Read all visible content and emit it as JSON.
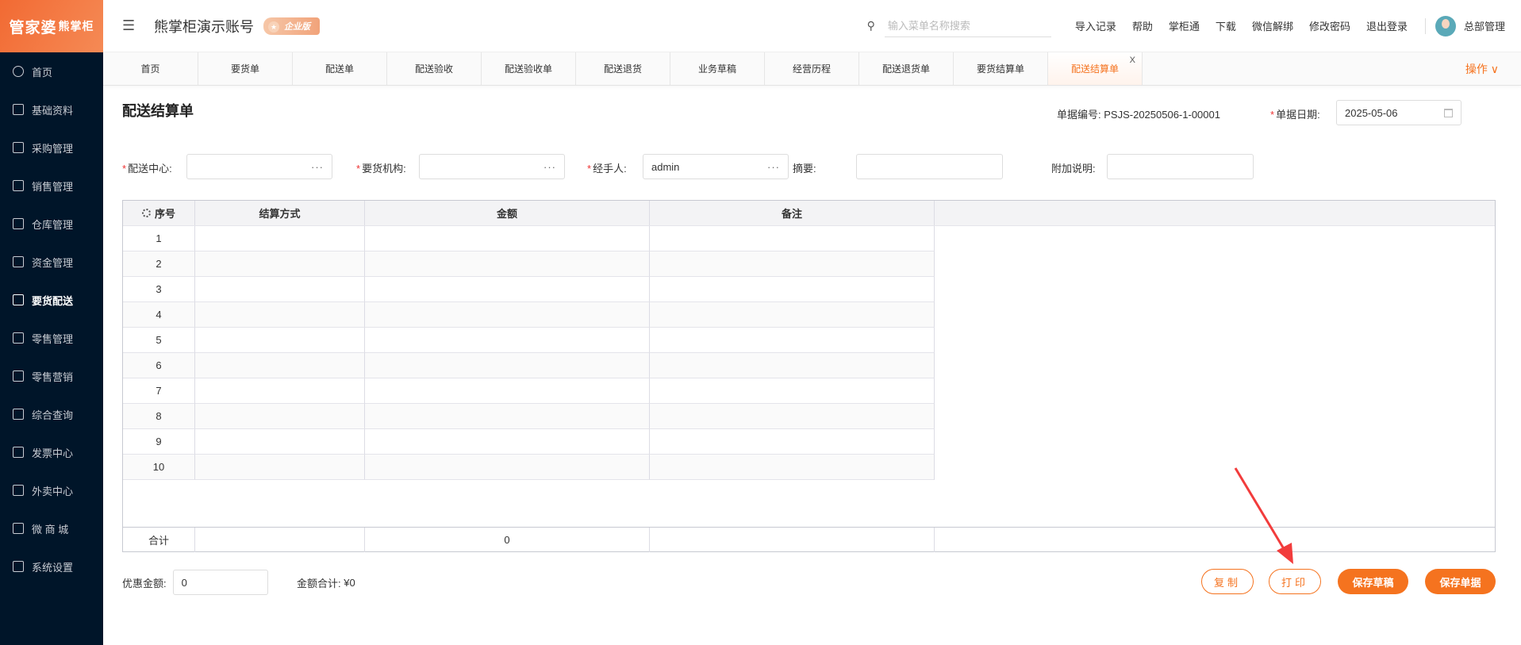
{
  "logo": {
    "main": "管家婆",
    "sub": "熊掌柜"
  },
  "sidebar": {
    "items": [
      {
        "label": "首页",
        "icon": "globe-icon"
      },
      {
        "label": "基础资料",
        "icon": "home-icon"
      },
      {
        "label": "采购管理",
        "icon": "cart-icon"
      },
      {
        "label": "销售管理",
        "icon": "sales-icon"
      },
      {
        "label": "仓库管理",
        "icon": "warehouse-icon"
      },
      {
        "label": "资金管理",
        "icon": "money-icon"
      },
      {
        "label": "要货配送",
        "icon": "document-icon",
        "active": true
      },
      {
        "label": "零售管理",
        "icon": "area-chart-icon"
      },
      {
        "label": "零售营销",
        "icon": "gift-icon"
      },
      {
        "label": "综合查询",
        "icon": "bar-chart-icon"
      },
      {
        "label": "发票中心",
        "icon": "line-chart-icon"
      },
      {
        "label": "外卖中心",
        "icon": "bell-icon"
      },
      {
        "label": "微 商 城",
        "icon": "bag-icon"
      },
      {
        "label": "系统设置",
        "icon": "gear-icon"
      }
    ]
  },
  "header": {
    "account": "熊掌柜演示账号",
    "edition": "企业版",
    "search_placeholder": "输入菜单名称搜索",
    "links": [
      "导入记录",
      "帮助",
      "掌柜通",
      "下载",
      "微信解绑",
      "修改密码",
      "退出登录"
    ],
    "user": "总部管理"
  },
  "tabs": {
    "items": [
      "首页",
      "要货单",
      "配送单",
      "配送验收",
      "配送验收单",
      "配送退货",
      "业务草稿",
      "经营历程",
      "配送退货单",
      "要货结算单",
      "配送结算单"
    ],
    "active": 10,
    "close": "X",
    "ops": "操作 ∨"
  },
  "form": {
    "title": "配送结算单",
    "doc_no_label": "单据编号:",
    "doc_no": "PSJS-20250506-1-00001",
    "date_label": "单据日期:",
    "date": "2025-05-06",
    "required_mark": "*",
    "dots": "···",
    "center_label": "配送中心:",
    "center": "",
    "org_label": "要货机构:",
    "org": "",
    "handler_label": "经手人:",
    "handler": "admin",
    "summary_label": "摘要:",
    "summary": "",
    "note_label": "附加说明:",
    "note": ""
  },
  "table": {
    "columns": [
      "序号",
      "结算方式",
      "金额",
      "备注"
    ],
    "rows": [
      "1",
      "2",
      "3",
      "4",
      "5",
      "6",
      "7",
      "8",
      "9",
      "10"
    ],
    "total_label": "合计",
    "total_amount": "0"
  },
  "footer": {
    "discount_label": "优惠金额:",
    "discount": "0",
    "sum_label": "金额合计:",
    "sum": "¥0",
    "buttons": {
      "copy": "复制",
      "print": "打印",
      "save_draft": "保存草稿",
      "save": "保存单据"
    }
  },
  "colors": {
    "accent": "#f5731f",
    "sidebar": "#001529",
    "annotation_arrow": "#f23c3c"
  }
}
